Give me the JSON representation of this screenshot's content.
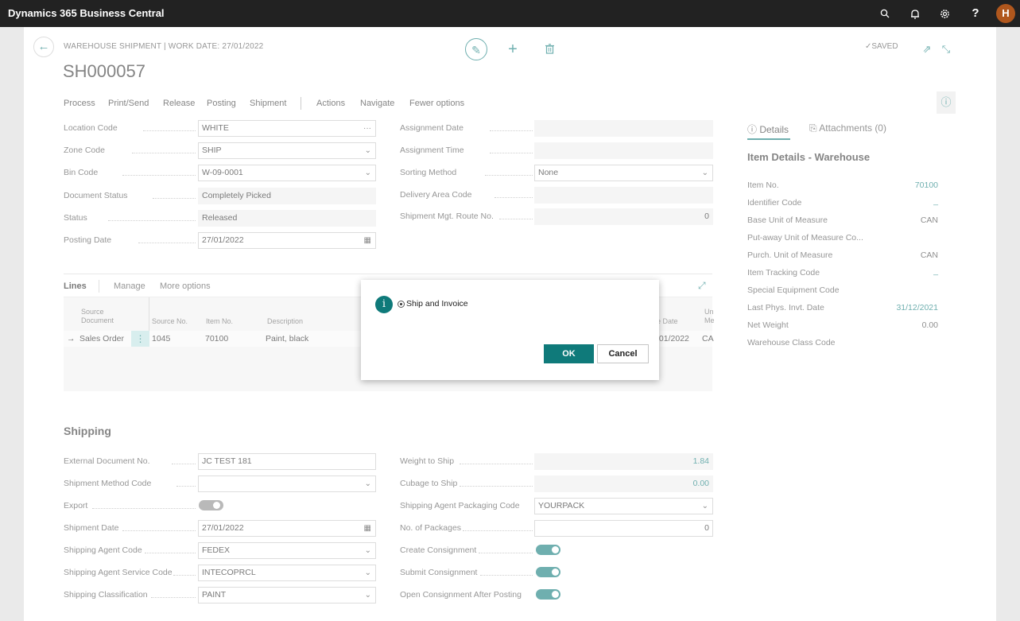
{
  "app": {
    "title": "Dynamics 365 Business Central",
    "avatar": "H"
  },
  "topbar_icons": [
    "search-icon",
    "bell-icon",
    "gear-icon",
    "help-icon"
  ],
  "page": {
    "caption": "WAREHOUSE SHIPMENT | WORK DATE: 27/01/2022",
    "record_no": "SH000057",
    "saved": "✓SAVED"
  },
  "menu": [
    "Process",
    "Print/Send",
    "Release",
    "Posting",
    "Shipment",
    "Actions",
    "Navigate",
    "Fewer options"
  ],
  "general_left": [
    {
      "label": "Location Code",
      "value": "WHITE",
      "icon": "···"
    },
    {
      "label": "Zone Code",
      "value": "SHIP",
      "icon": "⌄"
    },
    {
      "label": "Bin Code",
      "value": "W-09-0001",
      "icon": "⌄"
    },
    {
      "label": "Document Status",
      "value": "Completely Picked"
    },
    {
      "label": "Status",
      "value": "Released"
    },
    {
      "label": "Posting Date",
      "value": "27/01/2022",
      "icon": "▦"
    }
  ],
  "general_right": [
    {
      "label": "Assignment Date",
      "value": ""
    },
    {
      "label": "Assignment Time",
      "value": ""
    },
    {
      "label": "Sorting Method",
      "value": "None",
      "icon": "⌄"
    },
    {
      "label": "Delivery Area Code",
      "value": ""
    },
    {
      "label": "Shipment Mgt. Route No.",
      "value": "0"
    }
  ],
  "lines": {
    "title": "Lines",
    "tabs": [
      "Manage",
      "More options"
    ],
    "columns": {
      "source_document": "Source\nDocument",
      "source_no": "Source No.",
      "item_no": "Item No.",
      "description": "Description",
      "date_partial": "e Date",
      "unit_partial": "Un\nMe"
    },
    "row": {
      "arrow": "→",
      "source_document": "Sales Order",
      "source_no": "1045",
      "item_no": "70100",
      "description": "Paint, black",
      "date_partial": "/01/2022",
      "unit_partial": "CA"
    }
  },
  "shipping": {
    "title": "Shipping",
    "left": [
      {
        "label": "External Document No.",
        "value": "JC TEST 181"
      },
      {
        "label": "Shipment Method Code",
        "value": "",
        "icon": "⌄"
      },
      {
        "label": "Export",
        "toggle": false
      },
      {
        "label": "Shipment Date",
        "value": "27/01/2022",
        "icon": "▦"
      },
      {
        "label": "Shipping Agent Code",
        "value": "FEDEX",
        "icon": "⌄"
      },
      {
        "label": "Shipping Agent Service Code",
        "value": "INTECOPRCL",
        "icon": "⌄"
      },
      {
        "label": "Shipping Classification",
        "value": "PAINT",
        "icon": "⌄"
      }
    ],
    "right": [
      {
        "label": "Weight to Ship",
        "value": "1.84"
      },
      {
        "label": "Cubage to Ship",
        "value": "0.00"
      },
      {
        "label": "Shipping Agent Packaging Code",
        "value": "YOURPACK",
        "icon": "⌄"
      },
      {
        "label": "No. of Packages",
        "value": "0"
      },
      {
        "label": "Create Consignment",
        "toggle": true
      },
      {
        "label": "Submit Consignment",
        "toggle": true
      },
      {
        "label": "Open Consignment After Posting",
        "toggle": true
      }
    ]
  },
  "factbox": {
    "tab_details": "Details",
    "tab_attachments": "Attachments (0)",
    "title": "Item Details - Warehouse",
    "rows": [
      {
        "label": "Item No.",
        "value": "70100"
      },
      {
        "label": "Identifier Code",
        "value": "_"
      },
      {
        "label": "Base Unit of Measure",
        "value": "CAN"
      },
      {
        "label": "Put-away Unit of Measure Co...",
        "value": ""
      },
      {
        "label": "Purch. Unit of Measure",
        "value": "CAN"
      },
      {
        "label": "Item Tracking Code",
        "value": "_"
      },
      {
        "label": "Special Equipment Code",
        "value": ""
      },
      {
        "label": "Last Phys. Invt. Date",
        "value": "31/12/2021"
      },
      {
        "label": "Net Weight",
        "value": "0.00"
      },
      {
        "label": "Warehouse Class Code",
        "value": ""
      }
    ]
  },
  "dialog": {
    "icon": "i",
    "option": "Ship and Invoice",
    "ok": "OK",
    "cancel": "Cancel"
  }
}
